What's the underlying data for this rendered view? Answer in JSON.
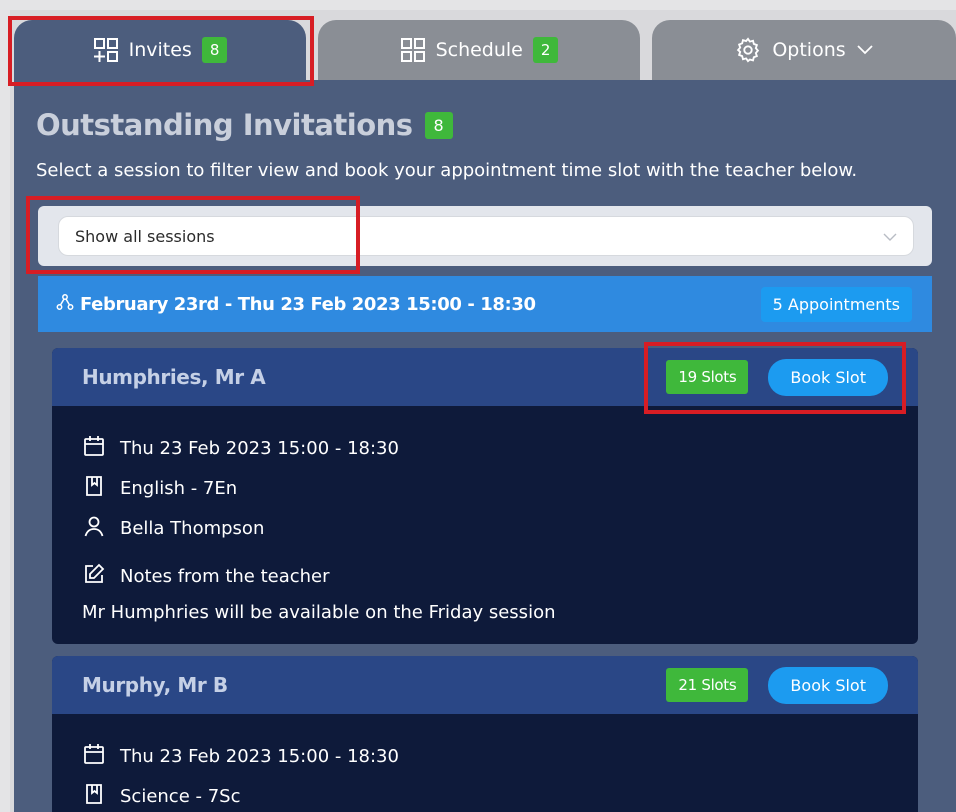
{
  "tabs": [
    {
      "label": "Invites",
      "badge": "8",
      "icon": "grid-plus-icon"
    },
    {
      "label": "Schedule",
      "badge": "2",
      "icon": "grid-icon"
    },
    {
      "label": "Options",
      "icon": "gear-icon",
      "chevron": "chevron-down-icon"
    }
  ],
  "main": {
    "title": "Outstanding Invitations",
    "title_badge": "8",
    "subtitle": "Select a session to filter view and book your appointment time slot with the teacher below.",
    "session_filter": {
      "value": "Show all sessions",
      "icon": "chevron-down-icon"
    }
  },
  "session": {
    "icon": "network-icon",
    "title": "February 23rd - Thu 23 Feb 2023 15:00 - 18:30",
    "appointments_badge": "5 Appointments"
  },
  "cards": [
    {
      "teacher": "Humphries, Mr A",
      "slots": "19 Slots",
      "book_label": "Book Slot",
      "datetime": "Thu 23 Feb 2023 15:00 - 18:30",
      "subject": "English - 7En",
      "student": "Bella Thompson",
      "notes_label": "Notes from the teacher",
      "notes_text": "Mr Humphries will be available on the Friday session"
    },
    {
      "teacher": "Murphy, Mr B",
      "slots": "21 Slots",
      "book_label": "Book Slot",
      "datetime": "Thu 23 Feb 2023 15:00 - 18:30",
      "subject": "Science - 7Sc"
    }
  ],
  "colors": {
    "panel": "#4c5d7d",
    "tab_inactive": "#8a8e95",
    "badge_green": "#3fb83b",
    "session_blue": "#2f8ae0",
    "button_blue": "#1c9bf0",
    "card_header": "#2a4786",
    "card_body": "#0e1a3a",
    "highlight_red": "#d71d24"
  }
}
